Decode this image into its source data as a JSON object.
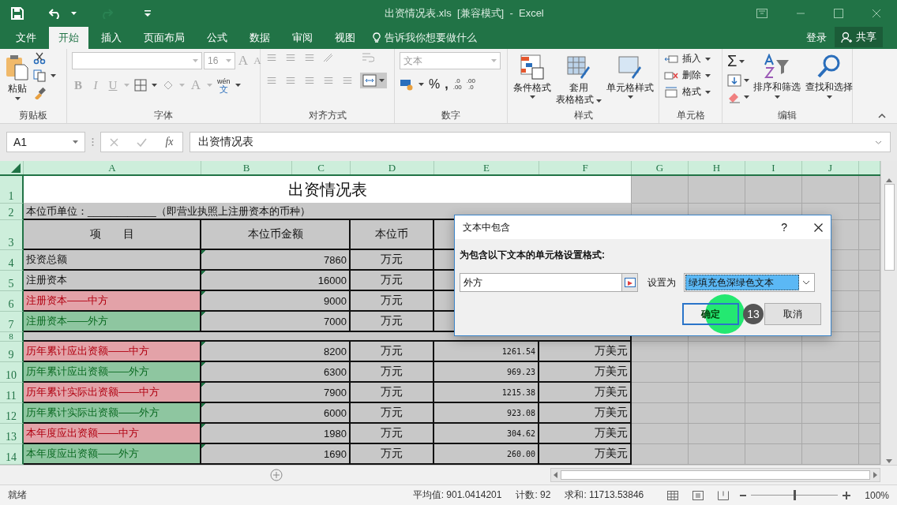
{
  "window": {
    "title": "出资情况表.xls  [兼容模式]  -  Excel"
  },
  "tabs": [
    {
      "label": "文件",
      "selected": false
    },
    {
      "label": "开始",
      "selected": true
    },
    {
      "label": "插入",
      "selected": false
    },
    {
      "label": "页面布局",
      "selected": false
    },
    {
      "label": "公式",
      "selected": false
    },
    {
      "label": "数据",
      "selected": false
    },
    {
      "label": "审阅",
      "selected": false
    },
    {
      "label": "视图",
      "selected": false
    }
  ],
  "tell_me": "告诉我你想要做什么",
  "sign_in": "登录",
  "share": "共享",
  "ribbon": {
    "clipboard": {
      "label": "剪贴板",
      "paste": "粘贴"
    },
    "font": {
      "label": "字体",
      "font_size": "16",
      "bold": "B",
      "italic": "I",
      "underline": "U",
      "grow": "A",
      "shrink": "A",
      "font_color": "A",
      "phonetic_top": "wén",
      "phonetic_bottom": "文"
    },
    "alignment": {
      "label": "对齐方式"
    },
    "number": {
      "label": "数字",
      "number_format": "文本",
      "percent": "%",
      "comma": ",",
      "increase_decimal": [
        ".0",
        ".00"
      ],
      "decrease_decimal": [
        ".00",
        ".0"
      ]
    },
    "styles": {
      "label": "样式",
      "buttons": [
        {
          "label": "条件格式"
        },
        {
          "label": "套用",
          "label2": "表格格式"
        },
        {
          "label": "单元格样式"
        }
      ]
    },
    "cells": {
      "label": "单元格",
      "buttons": [
        "插入",
        "删除",
        "格式"
      ]
    },
    "editing": {
      "label": "编辑",
      "sum": "Σ",
      "buttons": [
        "排序和筛选",
        "查找和选择"
      ]
    }
  },
  "formula_bar": {
    "name_box": "A1",
    "function_label": "fx",
    "value": "出资情况表"
  },
  "columns": [
    "A",
    "B",
    "C",
    "D",
    "E",
    "F",
    "G",
    "H",
    "I",
    "J"
  ],
  "rows": [
    {
      "number": "1",
      "kind": "title",
      "text": "出资情况表"
    },
    {
      "number": "2",
      "kind": "note",
      "text": "本位币单位：____________（即营业执照上注册资本的币种）"
    },
    {
      "number": "3",
      "kind": "header",
      "headings": [
        "项　　目",
        "本位币金额",
        "本位币"
      ]
    },
    {
      "number": "4",
      "kind": "data",
      "item": "投资总额",
      "amount": "7860",
      "unit": "万元"
    },
    {
      "number": "5",
      "kind": "data",
      "item": "注册资本",
      "amount": "16000",
      "unit": "万元"
    },
    {
      "number": "6",
      "kind": "data",
      "item": "注册资本——中方",
      "color": "#e3a2a8",
      "amount": "9000",
      "unit": "万元"
    },
    {
      "number": "7",
      "kind": "data",
      "item": "注册资本——外方",
      "color": "#8ec6a0",
      "amount": "7000",
      "unit": "万元"
    },
    {
      "number": "8",
      "kind": "blank"
    },
    {
      "number": "9",
      "kind": "data",
      "item": "历年累计应出资额——中方",
      "color": "#e3a2a8",
      "amount": "8200",
      "unit": "万元",
      "usd": "1261.54",
      "usd_unit": "万美元"
    },
    {
      "number": "10",
      "kind": "data",
      "item": "历年累计应出资额——外方",
      "color": "#8ec6a0",
      "amount": "6300",
      "unit": "万元",
      "usd": "969.23",
      "usd_unit": "万美元"
    },
    {
      "number": "11",
      "kind": "data",
      "item": "历年累计实际出资额——中方",
      "color": "#e3a2a8",
      "amount": "7900",
      "unit": "万元",
      "usd": "1215.38",
      "usd_unit": "万美元"
    },
    {
      "number": "12",
      "kind": "data",
      "item": "历年累计实际出资额——外方",
      "color": "#8ec6a0",
      "amount": "6000",
      "unit": "万元",
      "usd": "923.08",
      "usd_unit": "万美元"
    },
    {
      "number": "13",
      "kind": "data",
      "item": "本年度应出资额——中方",
      "color": "#e3a2a8",
      "amount": "1980",
      "unit": "万元",
      "usd": "304.62",
      "usd_unit": "万美元"
    },
    {
      "number": "14",
      "kind": "data",
      "item": "本年度应出资额——外方",
      "color": "#8ec6a0",
      "amount": "1690",
      "unit": "万元",
      "usd": "260.00",
      "usd_unit": "万美元"
    }
  ],
  "dialog": {
    "title": "文本中包含",
    "help": "?",
    "prompt": "为包含以下文本的单元格设置格式:",
    "text_value": "外方",
    "set_as_label": "设置为",
    "format_value": "绿填充色深绿色文本",
    "ok": "确定",
    "cancel": "取消",
    "step_badge": "13"
  },
  "status_bar": {
    "status": "就绪",
    "average": "平均值: 901.0414201",
    "count": "计数: 92",
    "sum": "求和: 11713.53846",
    "zoom": {
      "level": 0.5
    },
    "zoom_label": "100%"
  }
}
